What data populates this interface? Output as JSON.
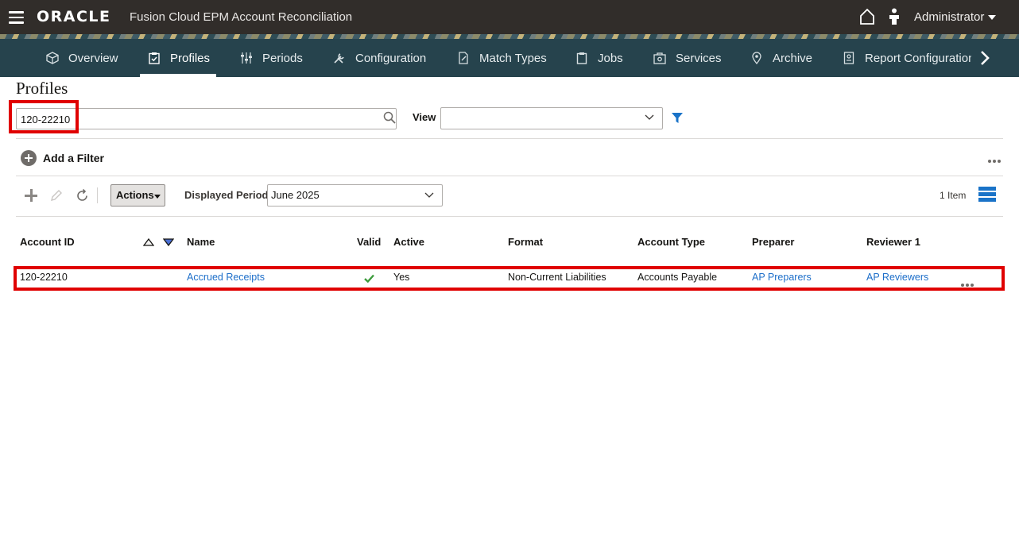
{
  "header": {
    "brand": "ORACLE",
    "app_title": "Fusion Cloud EPM Account Reconciliation",
    "user_name": "Administrator"
  },
  "nav": {
    "tabs": [
      {
        "label": "Overview",
        "icon": "cube-icon",
        "active": false
      },
      {
        "label": "Profiles",
        "icon": "clipboard-check-icon",
        "active": true
      },
      {
        "label": "Periods",
        "icon": "sliders-icon",
        "active": false
      },
      {
        "label": "Configuration",
        "icon": "tools-icon",
        "active": false
      },
      {
        "label": "Match Types",
        "icon": "document-edit-icon",
        "active": false
      },
      {
        "label": "Jobs",
        "icon": "clipboard-icon",
        "active": false
      },
      {
        "label": "Services",
        "icon": "briefcase-gear-icon",
        "active": false
      },
      {
        "label": "Archive",
        "icon": "location-pin-icon",
        "active": false
      },
      {
        "label": "Report Configuration",
        "icon": "report-icon",
        "active": false
      }
    ]
  },
  "page": {
    "title": "Profiles",
    "search_value": "120-22210",
    "view_label": "View",
    "view_value": "",
    "add_filter_label": "Add a Filter"
  },
  "toolbar": {
    "actions_label": "Actions",
    "displayed_period_label": "Displayed Period",
    "displayed_period_value": "June 2025",
    "item_count": "1 Item"
  },
  "table": {
    "columns": [
      "Account ID",
      "Name",
      "Valid",
      "Active",
      "Format",
      "Account Type",
      "Preparer",
      "Reviewer 1"
    ],
    "rows": [
      {
        "account_id": "120-22210",
        "name": "Accrued Receipts",
        "valid": true,
        "active": "Yes",
        "format": "Non-Current Liabilities",
        "account_type": "Accounts Payable",
        "preparer": "AP Preparers",
        "reviewer_1": "AP Reviewers"
      }
    ]
  },
  "colors": {
    "topbar": "#312d2a",
    "navbar": "#26434d",
    "link": "#1c6ec9",
    "highlight": "#e00000",
    "valid": "#3c9b3c"
  }
}
